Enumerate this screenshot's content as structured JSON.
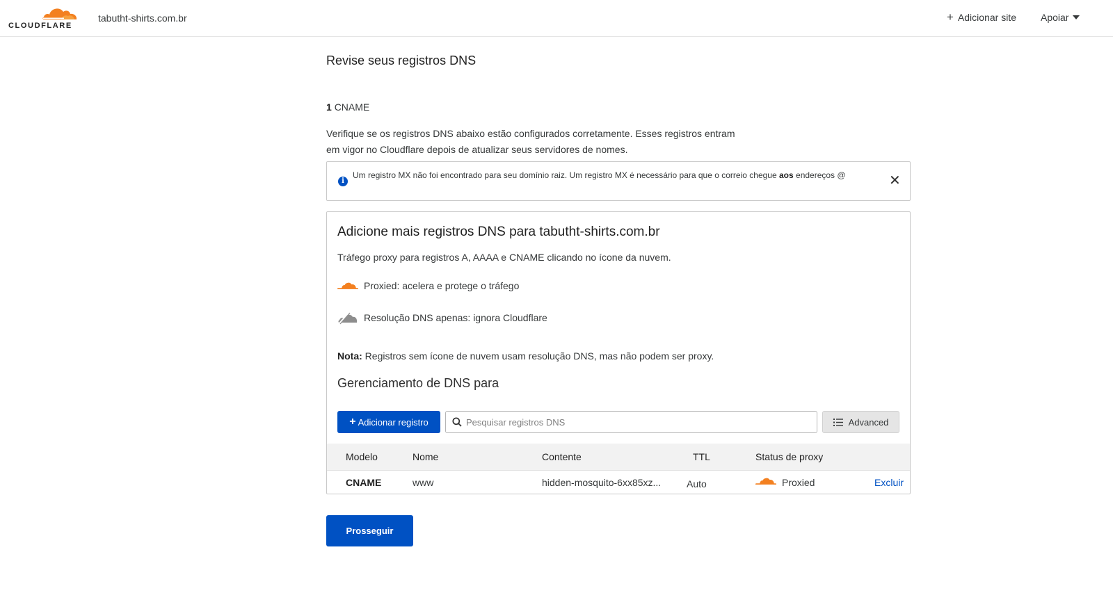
{
  "header": {
    "logo_text": "CLOUDFLARE",
    "site_name": "tabutht-shirts.com.br",
    "add_site_label": "Adicionar site",
    "support_label": "Apoiar"
  },
  "main": {
    "title": "Revise seus registros DNS",
    "record_count": "1",
    "record_type_summary": "CNAME",
    "description": "Verifique se os registros DNS abaixo estão configurados corretamente. Esses registros entram em vigor no Cloudflare depois de atualizar seus servidores de nomes.",
    "info_notice": {
      "text_before": "Um registro MX não foi encontrado para seu domínio raiz. Um registro MX é necessário para que o correio chegue",
      "text_bold": "aos",
      "text_after": "endereços @"
    }
  },
  "card": {
    "title": "Adicione mais registros DNS para tabutht-shirts.com.br",
    "subtitle": "Tráfego proxy para registros A, AAAA e CNAME clicando no ícone da nuvem.",
    "proxied_legend": "Proxied: acelera e protege o tráfego",
    "dns_only_legend": "Resolução DNS apenas: ignora Cloudflare",
    "note_label": "Nota:",
    "note_text": "Registros sem ícone de nuvem usam resolução DNS, mas não podem ser proxy.",
    "management_title": "Gerenciamento de DNS para",
    "add_record_label": "Adicionar registro",
    "search_placeholder": "Pesquisar registros DNS",
    "advanced_label": "Advanced",
    "columns": [
      "Modelo",
      "Nome",
      "Contente",
      "TTL",
      "Status de proxy"
    ],
    "rows": [
      {
        "type": "CNAME",
        "name": "www",
        "content": "hidden-mosquito-6xx85xz...",
        "ttl": "Auto",
        "proxy_status": "Proxied",
        "action": "Excluir"
      }
    ]
  },
  "footer": {
    "continue_label": "Prosseguir"
  },
  "colors": {
    "brand_orange": "#f38020",
    "primary_blue": "#0051c3",
    "dns_only_gray": "#8d8d8d"
  }
}
